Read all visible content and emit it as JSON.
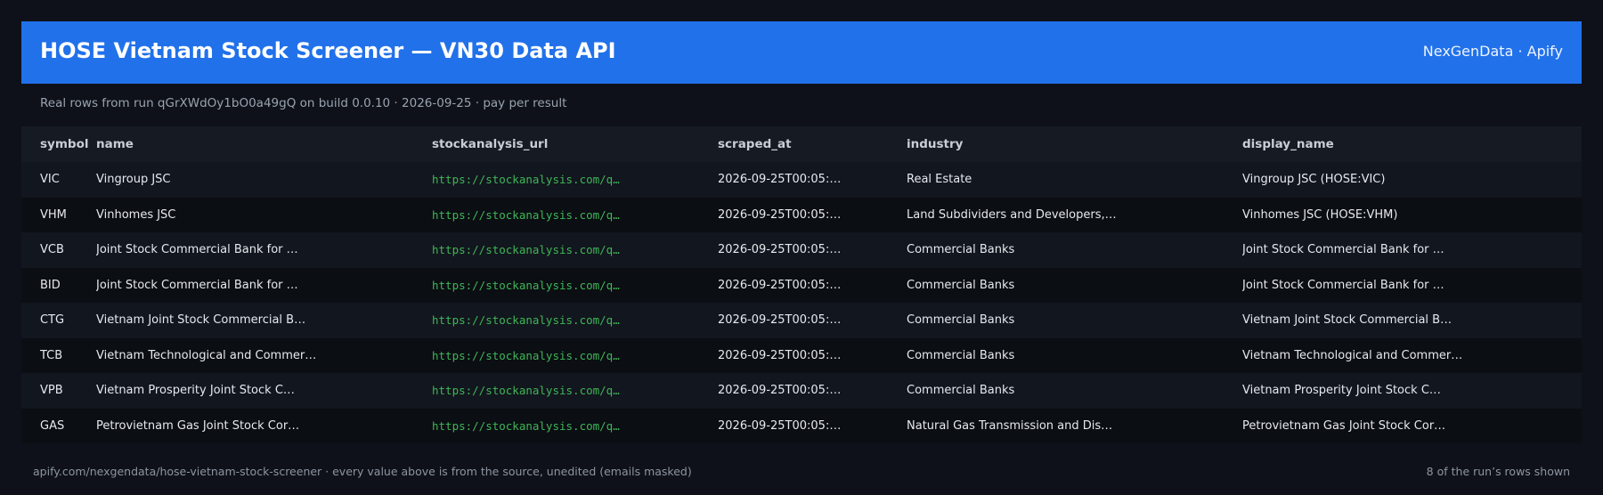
{
  "header": {
    "title": "HOSE Vietnam Stock Screener — VN30 Data API",
    "brand": "NexGenData · Apify"
  },
  "subtitle": "Real rows from run qGrXWdOy1bO0a49gQ on build 0.0.10 · 2026-09-25 · pay per result",
  "table": {
    "columns": [
      "symbol",
      "name",
      "stockanalysis_url",
      "scraped_at",
      "industry",
      "display_name"
    ],
    "rows": [
      [
        "VIC",
        "Vingroup JSC",
        "https://stockanalysis.com/q…",
        "2026-09-25T00:05:…",
        "Real Estate",
        "Vingroup JSC (HOSE:VIC)"
      ],
      [
        "VHM",
        "Vinhomes JSC",
        "https://stockanalysis.com/q…",
        "2026-09-25T00:05:…",
        "Land Subdividers and Developers,…",
        "Vinhomes JSC (HOSE:VHM)"
      ],
      [
        "VCB",
        "Joint Stock Commercial Bank for …",
        "https://stockanalysis.com/q…",
        "2026-09-25T00:05:…",
        "Commercial Banks",
        "Joint Stock Commercial Bank for …"
      ],
      [
        "BID",
        "Joint Stock Commercial Bank for …",
        "https://stockanalysis.com/q…",
        "2026-09-25T00:05:…",
        "Commercial Banks",
        "Joint Stock Commercial Bank for …"
      ],
      [
        "CTG",
        "Vietnam Joint Stock Commercial B…",
        "https://stockanalysis.com/q…",
        "2026-09-25T00:05:…",
        "Commercial Banks",
        "Vietnam Joint Stock Commercial B…"
      ],
      [
        "TCB",
        "Vietnam Technological and Commer…",
        "https://stockanalysis.com/q…",
        "2026-09-25T00:05:…",
        "Commercial Banks",
        "Vietnam Technological and Commer…"
      ],
      [
        "VPB",
        "Vietnam Prosperity Joint Stock C…",
        "https://stockanalysis.com/q…",
        "2026-09-25T00:05:…",
        "Commercial Banks",
        "Vietnam Prosperity Joint Stock C…"
      ],
      [
        "GAS",
        "Petrovietnam Gas Joint Stock Cor…",
        "https://stockanalysis.com/q…",
        "2026-09-25T00:05:…",
        "Natural Gas Transmission and Dis…",
        "Petrovietnam Gas Joint Stock Cor…"
      ]
    ]
  },
  "footer": {
    "left": "apify.com/nexgendata/hose-vietnam-stock-screener  ·  every value above is from the source, unedited (emails masked)",
    "right": "8 of the run’s rows shown"
  },
  "colors": {
    "background": "#0e1119",
    "header": "#2171ea",
    "url": "#3fb657"
  }
}
